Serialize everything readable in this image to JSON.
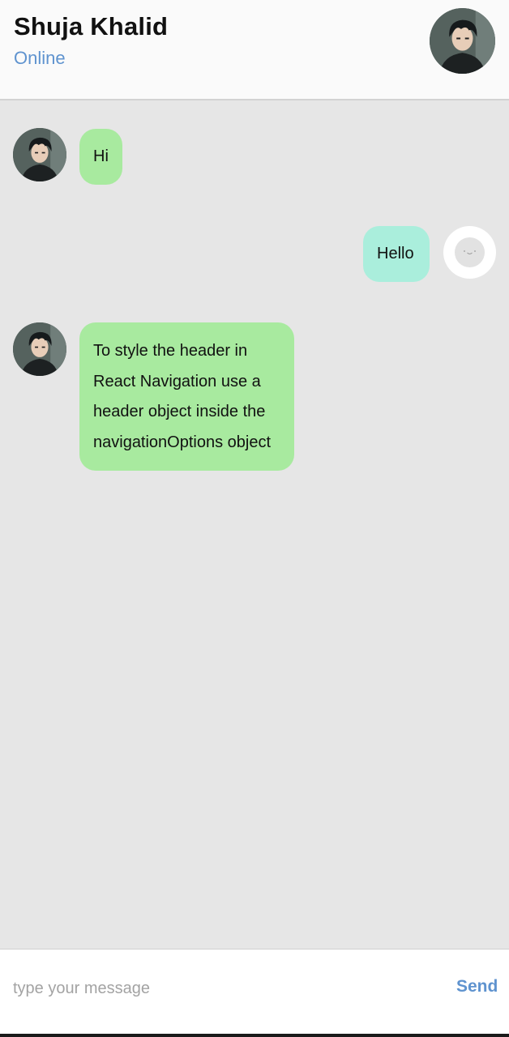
{
  "header": {
    "contact_name": "Shuja Khalid",
    "status": "Online",
    "avatar_icon": "anime-profile-avatar"
  },
  "messages": [
    {
      "direction": "received",
      "text": "Hi"
    },
    {
      "direction": "sent",
      "text": "Hello"
    },
    {
      "direction": "received",
      "text": "To style the header in React Navigation use a header object inside the navigationOptions object"
    }
  ],
  "composer": {
    "placeholder": "type your message",
    "value": "",
    "send_label": "Send"
  },
  "colors": {
    "received_bubble": "#a8ea9f",
    "sent_bubble": "#aaeedc",
    "accent": "#5f93cf",
    "chat_background": "#e6e6e6"
  }
}
